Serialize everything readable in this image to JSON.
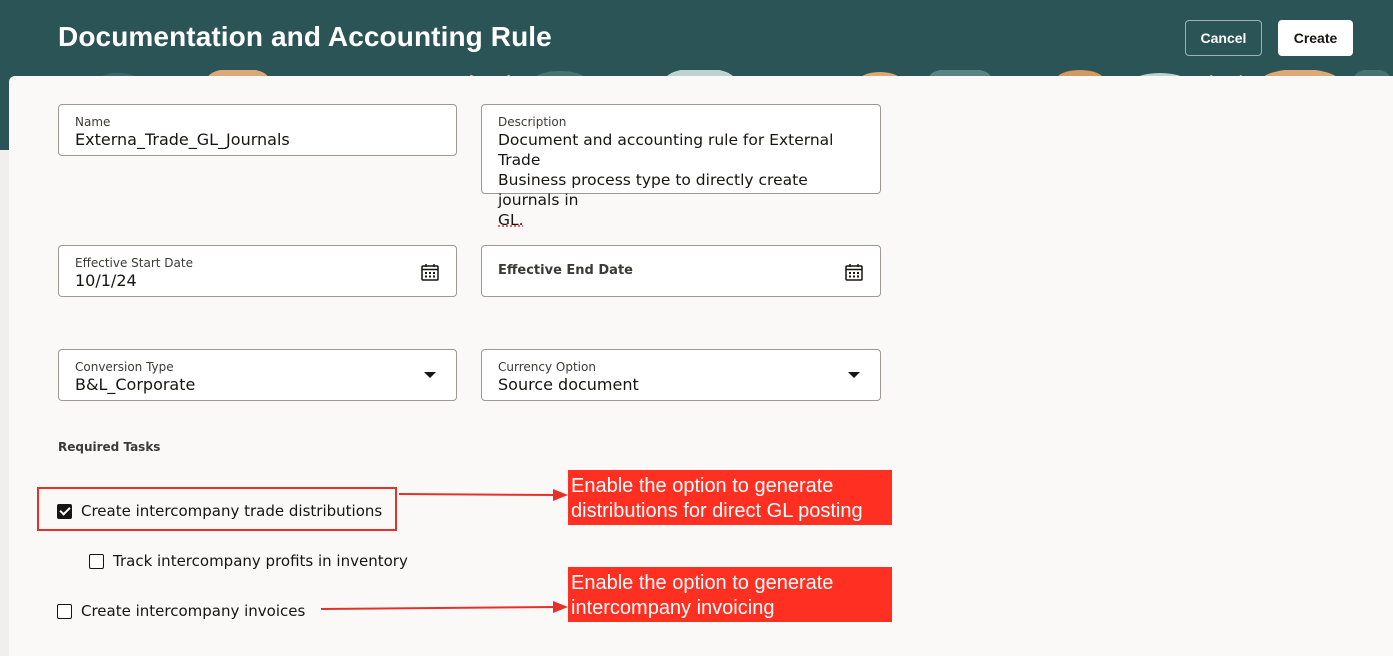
{
  "header": {
    "title": "Documentation and Accounting Rule",
    "cancel_label": "Cancel",
    "create_label": "Create"
  },
  "form": {
    "name": {
      "label": "Name",
      "value": "Externa_Trade_GL_Journals"
    },
    "description": {
      "label": "Description",
      "lines": [
        "Document and accounting rule for External Trade",
        "Business process type to directly create journals in",
        "GL."
      ]
    },
    "effective_start_date": {
      "label": "Effective Start Date",
      "value": "10/1/24"
    },
    "effective_end_date": {
      "label": "Effective End Date",
      "value": ""
    },
    "conversion_type": {
      "label": "Conversion Type",
      "value": "B&L_Corporate"
    },
    "currency_option": {
      "label": "Currency Option",
      "value": "Source document"
    }
  },
  "required_tasks": {
    "label": "Required Tasks",
    "items": [
      {
        "label": "Create intercompany trade distributions",
        "checked": true
      },
      {
        "label": "Track intercompany profits in inventory",
        "checked": false
      },
      {
        "label": "Create intercompany invoices",
        "checked": false
      }
    ]
  },
  "annotations": {
    "callout_1": [
      "Enable the option to generate",
      "distributions for direct GL posting"
    ],
    "callout_2": [
      "Enable the option to generate",
      "intercompany invoicing"
    ],
    "color": "#ff2f21"
  },
  "theme": {
    "header_bg": "#2b5457",
    "panel_bg": "#fbf9f8"
  },
  "icons": [
    "calendar-icon",
    "chevron-down-icon",
    "checkbox-checked-icon",
    "checkbox-unchecked-icon",
    "arrow-icon"
  ]
}
